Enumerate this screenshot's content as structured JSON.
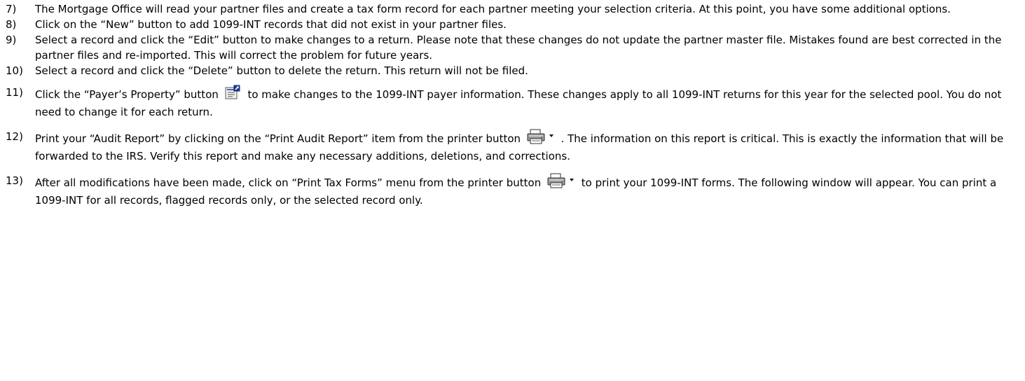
{
  "steps": [
    {
      "num": "7)",
      "text": "The Mortgage Office will read your partner files and create a tax form record for each partner meeting your selection criteria. At this point, you have some additional options."
    },
    {
      "num": "8)",
      "text": "Click on the “New” button to add 1099-INT records that did not exist in your partner files."
    },
    {
      "num": "9)",
      "text": "Select a record and click the “Edit” button to make changes to a return. Please note that these changes do not update the partner master file. Mistakes found are best corrected in the partner files and re-imported. This will correct the problem for future years."
    },
    {
      "num": "10)",
      "text": "Select a record and click the “Delete” button to delete the return. This return will not be filed."
    },
    {
      "num": "11)",
      "text_before": "Click the “Payer’s Property” button",
      "text_after": "to make changes to the 1099-INT payer information. These changes apply to all 1099-INT returns for this year for the selected pool. You do not need to change it for each return.",
      "icon": "payer-property-icon"
    },
    {
      "num": "12)",
      "text_before": "Print your “Audit Report” by clicking on the “Print Audit Report” item from the printer button",
      "text_after": ". The information on this report is critical. This is exactly the information that will be forwarded to the IRS. Verify this report and make any necessary additions, deletions, and corrections.",
      "icon": "printer-dropdown-icon"
    },
    {
      "num": "13)",
      "text_before": "After all modifications have been made, click on “Print Tax Forms” menu from the printer button",
      "text_after": "to print your 1099-INT forms. The following window will appear. You can print a 1099-INT for all records, flagged records only, or the selected record only.",
      "icon": "printer-dropdown-icon"
    }
  ]
}
